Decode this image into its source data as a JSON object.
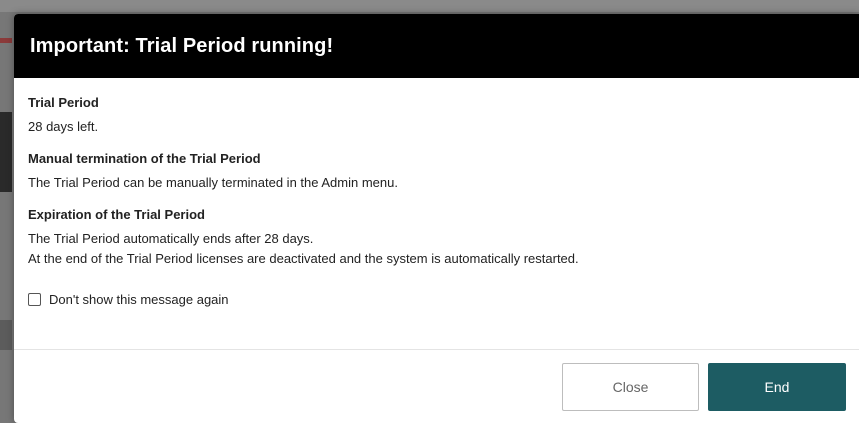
{
  "dialog": {
    "title": "Important: Trial Period running!",
    "sections": [
      {
        "heading": "Trial Period",
        "lines": [
          "28 days left."
        ]
      },
      {
        "heading": "Manual termination of the Trial Period",
        "lines": [
          "The Trial Period can be manually terminated in the Admin menu."
        ]
      },
      {
        "heading": "Expiration of the Trial Period",
        "lines": [
          "The Trial Period automatically ends after 28 days.",
          "At the end of the Trial Period licenses are deactivated and the system is automatically restarted."
        ]
      }
    ],
    "checkbox": {
      "label": "Don't show this message again",
      "checked": false
    },
    "buttons": {
      "close_label": "Close",
      "end_label": "End"
    }
  },
  "colors": {
    "header_bg": "#000000",
    "primary_button": "#1d5c63",
    "overlay": "#777777"
  }
}
